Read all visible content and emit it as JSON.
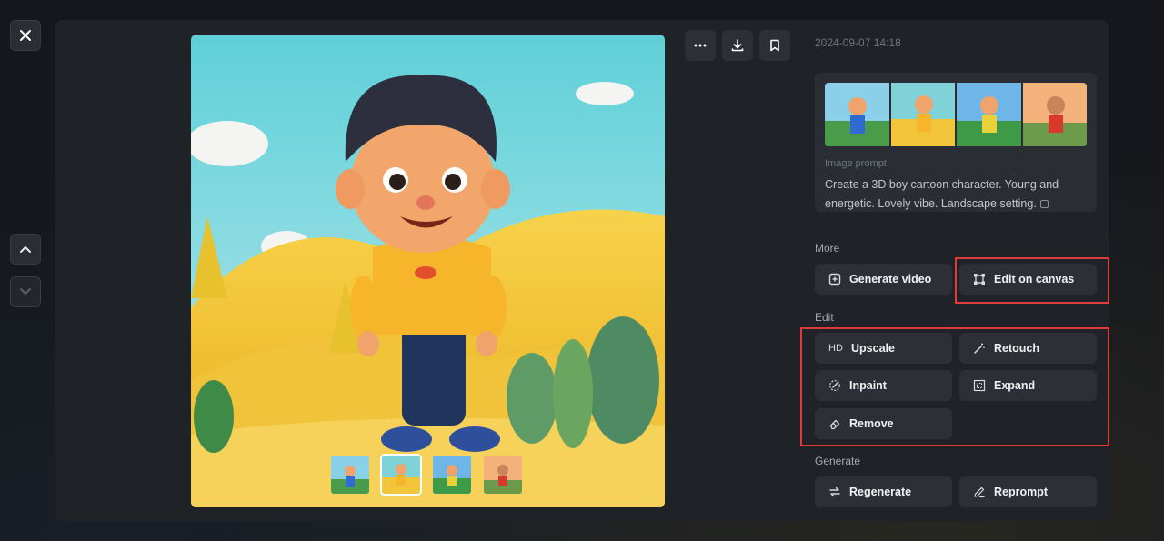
{
  "viewer": {
    "close_icon": "close-icon",
    "prev_icon": "chevron-up-icon",
    "next_icon": "chevron-down-icon"
  },
  "toolbar": {
    "more_icon": "more-horizontal-icon",
    "download_icon": "download-icon",
    "bookmark_icon": "bookmark-icon"
  },
  "details": {
    "timestamp": "2024-09-07 14:18",
    "prompt_label": "Image prompt",
    "prompt_text": "Create a 3D boy cartoon character. Young and energetic. Lovely vibe. Landscape setting."
  },
  "sections": {
    "more": "More",
    "edit": "Edit",
    "generate": "Generate"
  },
  "actions": {
    "generate_video": "Generate video",
    "edit_on_canvas": "Edit on canvas",
    "upscale": "Upscale",
    "upscale_icon_text": "HD",
    "retouch": "Retouch",
    "inpaint": "Inpaint",
    "expand": "Expand",
    "remove": "Remove",
    "regenerate": "Regenerate",
    "reprompt": "Reprompt"
  },
  "colors": {
    "panel": "#1f2227",
    "button": "#2c2f35",
    "highlight": "#e03a3a"
  }
}
